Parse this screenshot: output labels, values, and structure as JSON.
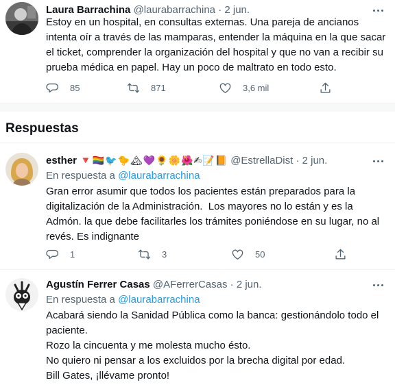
{
  "main_tweet": {
    "name": "Laura Barrachina",
    "handle": "@laurabarrachina",
    "separator": "·",
    "date": "2 jun.",
    "text": "Estoy en un hospital, en consultas externas. Una pareja de ancianos intenta oír a través de las mamparas, entender la máquina en la que sacar el ticket, comprender la organización del hospital y que no van a recibir su prueba médica en papel. Hay un poco de maltrato en todo esto.",
    "replies": "85",
    "retweets": "871",
    "likes": "3,6 mil"
  },
  "section": {
    "title": "Respuestas"
  },
  "replies": [
    {
      "name": "esther",
      "emojis": "🔻🏳️‍🌈🐦🐤🏔💜🌻🌼🌺✍📝📙",
      "handle": "@EstrellaDist",
      "separator": "·",
      "date": "2 jun.",
      "reply_prefix": "En respuesta a",
      "reply_to": "@laurabarrachina",
      "text": "Gran error asumir que todos los pacientes están preparados para la digitalización de la Administración.  Los mayores no lo están y es la Admón. la que debe facilitarles los trámites poniéndose en su lugar, no al revés. Es indignante",
      "replies": "1",
      "retweets": "3",
      "likes": "50"
    },
    {
      "name": "Agustín Ferrer Casas",
      "handle": "@AFerrerCasas",
      "separator": "·",
      "date": "2 jun.",
      "reply_prefix": "En respuesta a",
      "reply_to": "@laurabarrachina",
      "text": "Acabará siendo la Sanidad Pública como la banca: gestionándolo todo el paciente.\nRozo la cincuenta y me molesta mucho ésto.\nNo quiero ni pensar a los excluidos por la brecha digital por edad.\nBill Gates, ¡llévame pronto!"
    }
  ],
  "icons": {
    "reply": "reply-icon",
    "retweet": "retweet-icon",
    "like": "heart-icon",
    "share": "share-icon",
    "more": "more-icon"
  },
  "colors": {
    "link": "#1d9bf0",
    "secondary": "#536471",
    "text": "#0f1419"
  }
}
